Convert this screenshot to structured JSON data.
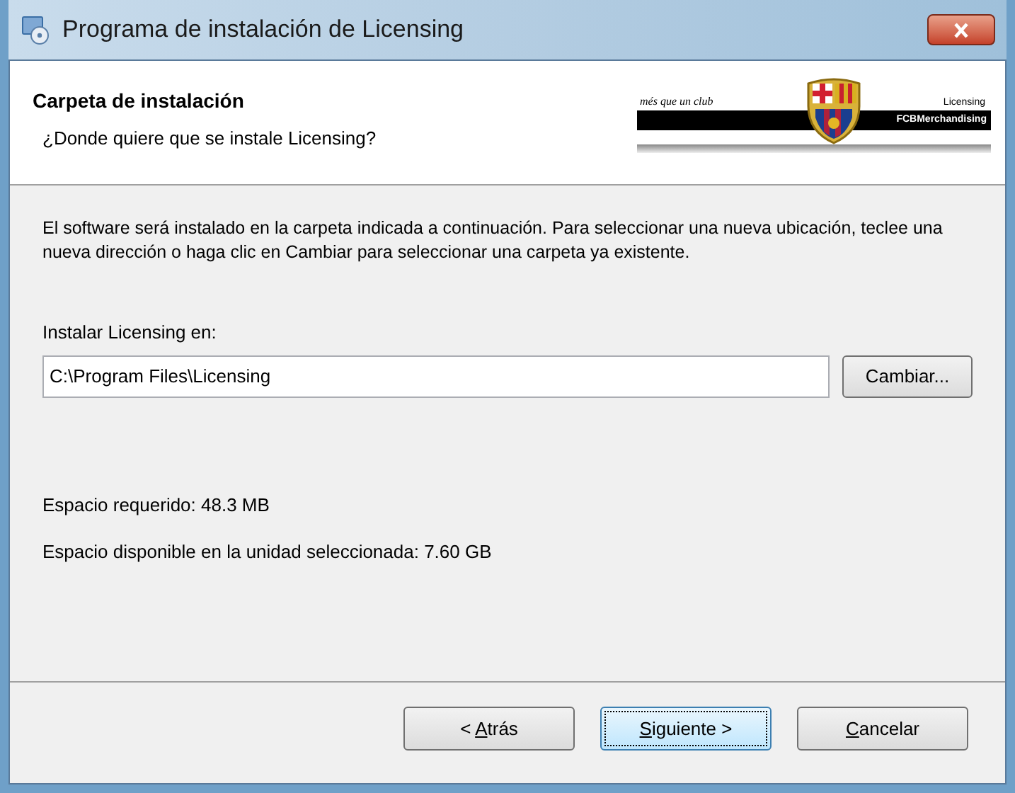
{
  "window": {
    "title": "Programa de instalación de Licensing"
  },
  "header": {
    "title": "Carpeta de instalación",
    "subtitle": "¿Donde quiere que se instale Licensing?",
    "banner": {
      "motto": "més que un club",
      "product": "Licensing",
      "brand": "FCBMerchandising"
    }
  },
  "description": "El software será instalado en la carpeta indicada a continuación. Para seleccionar una nueva ubicación, teclee una nueva dirección o haga clic en Cambiar para seleccionar una carpeta ya existente.",
  "folder": {
    "label": "Instalar Licensing en:",
    "value": "C:\\Program Files\\Licensing",
    "button": "Cambiar..."
  },
  "space": [
    "Espacio requerido: 48.3 MB",
    "Espacio disponible en la unidad seleccionada: 7.60 GB"
  ],
  "buttons": [
    {
      "before": "< ",
      "key": "A",
      "after": "trás",
      "focused": false
    },
    {
      "key": "S",
      "after": "iguiente >",
      "focused": true
    },
    {
      "key": "C",
      "after": "ancelar",
      "focused": false
    }
  ]
}
